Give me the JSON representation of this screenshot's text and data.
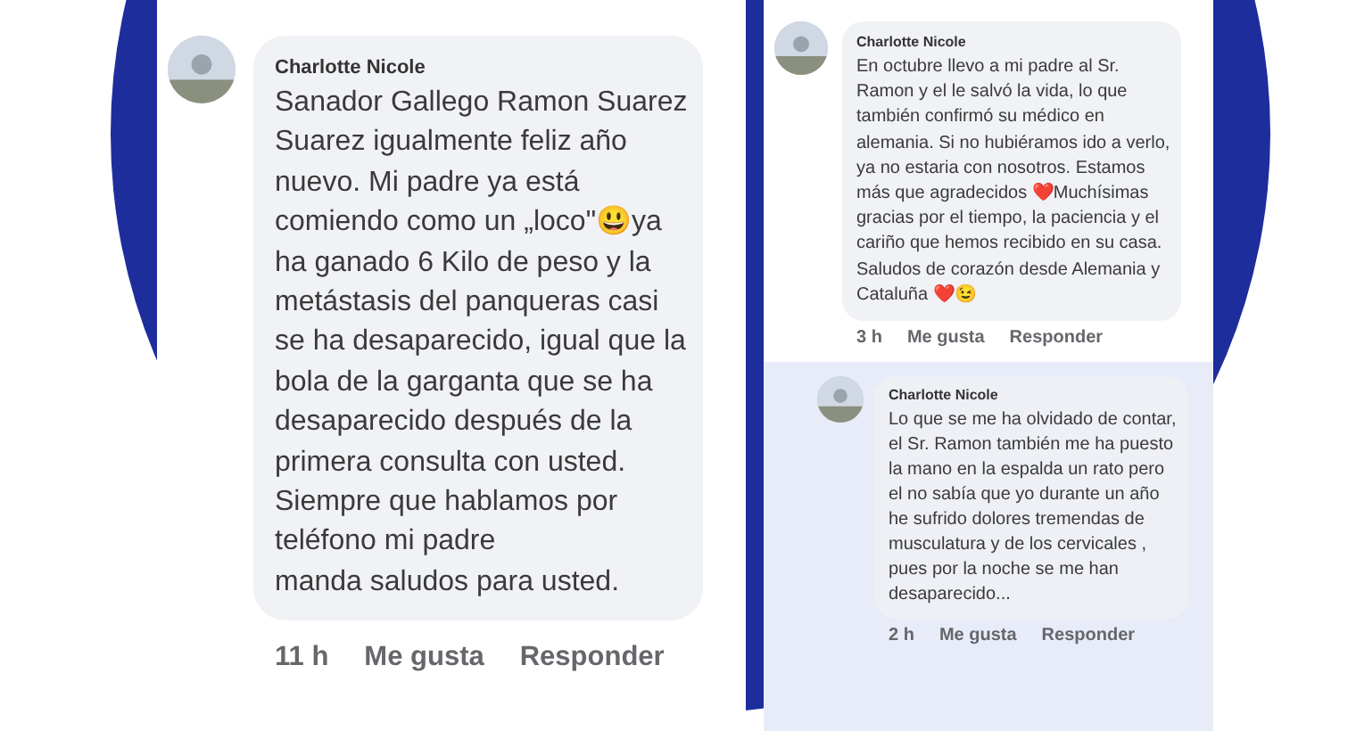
{
  "panels": [
    {
      "comments": [
        {
          "kind": "comment",
          "author": "Charlotte Nicole",
          "text": "Sanador Gallego Ramon Suarez Suarez igualmente feliz año nuevo. Mi padre ya está comiendo como un „loco\"😃ya ha ganado 6 Kilo de peso y la metástasis del panqueras casi se ha desaparecido, igual que la bola de la garganta que se ha desaparecido después de la primera consulta con usted. Siempre que hablamos por teléfono mi padre\nmanda saludos para usted.",
          "time": "11 h",
          "like": "Me gusta",
          "reply": "Responder"
        }
      ]
    },
    {
      "comments": [
        {
          "kind": "comment",
          "author": "Charlotte Nicole",
          "text": "En octubre llevo a mi padre al Sr. Ramon y el le salvó la vida, lo que también confirmó su médico en alemania. Si no hubiéramos ido a verlo, ya no estaria con nosotros. Estamos más que agradecidos ❤️Muchísimas gracias por el tiempo, la paciencia y el cariño que hemos recibido en su casa. Saludos de corazón desde Alemania  y Cataluña ❤️😉",
          "time": "3 h",
          "like": "Me gusta",
          "reply": "Responder"
        },
        {
          "kind": "reply",
          "author": "Charlotte Nicole",
          "text": "Lo que se me ha olvidado de contar, el Sr. Ramon también me ha puesto la mano en la espalda un rato pero el no sabía que yo durante un año he sufrido dolores tremendas de musculatura y de los cervicales , pues por la noche se me han desaparecido...",
          "time": "2 h",
          "like": "Me gusta",
          "reply": "Responder"
        }
      ]
    }
  ]
}
